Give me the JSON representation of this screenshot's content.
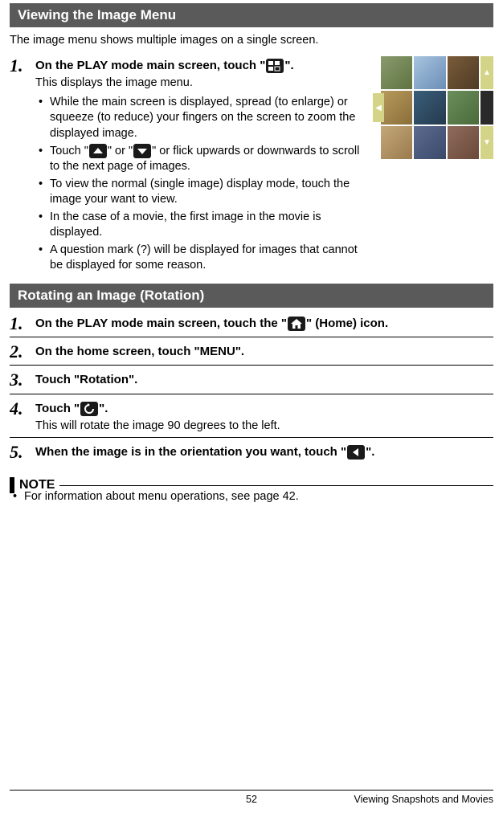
{
  "section1": {
    "title": "Viewing the Image Menu",
    "intro": "The image menu shows multiple images on a single screen.",
    "step1": {
      "num": "1.",
      "bold_pre": "On the PLAY mode main screen, touch \"",
      "bold_post": "\".",
      "line1": "This displays the image menu.",
      "bullets": [
        "While the main screen is displayed, spread (to enlarge) or squeeze (to reduce) your fingers on the screen to zoom the displayed image.",
        null,
        "To view the normal (single image) display mode, touch the image your want to view.",
        "In the case of a movie, the first image in the movie is displayed.",
        "A question mark (?) will be displayed for images that cannot be displayed for some reason."
      ],
      "b2_pre": "Touch \"",
      "b2_mid": "\" or \"",
      "b2_post": "\" or flick upwards or downwards to scroll to the next page of images."
    }
  },
  "section2": {
    "title": "Rotating an Image (Rotation)",
    "step1": {
      "num": "1.",
      "bold_pre": "On the PLAY mode main screen, touch the \"",
      "bold_post": "\" (Home) icon."
    },
    "step2": {
      "num": "2.",
      "bold": "On the home screen, touch \"MENU\"."
    },
    "step3": {
      "num": "3.",
      "bold": "Touch \"Rotation\"."
    },
    "step4": {
      "num": "4.",
      "bold_pre": "Touch \"",
      "bold_post": "\".",
      "plain": "This will rotate the image 90 degrees to the left."
    },
    "step5": {
      "num": "5.",
      "bold_pre": "When the image is in the orientation you want, touch \"",
      "bold_post": "\"."
    }
  },
  "note": {
    "label": "NOTE",
    "bullet": "For information about menu operations, see page 42."
  },
  "footer": {
    "page": "52",
    "right": "Viewing Snapshots and Movies"
  }
}
